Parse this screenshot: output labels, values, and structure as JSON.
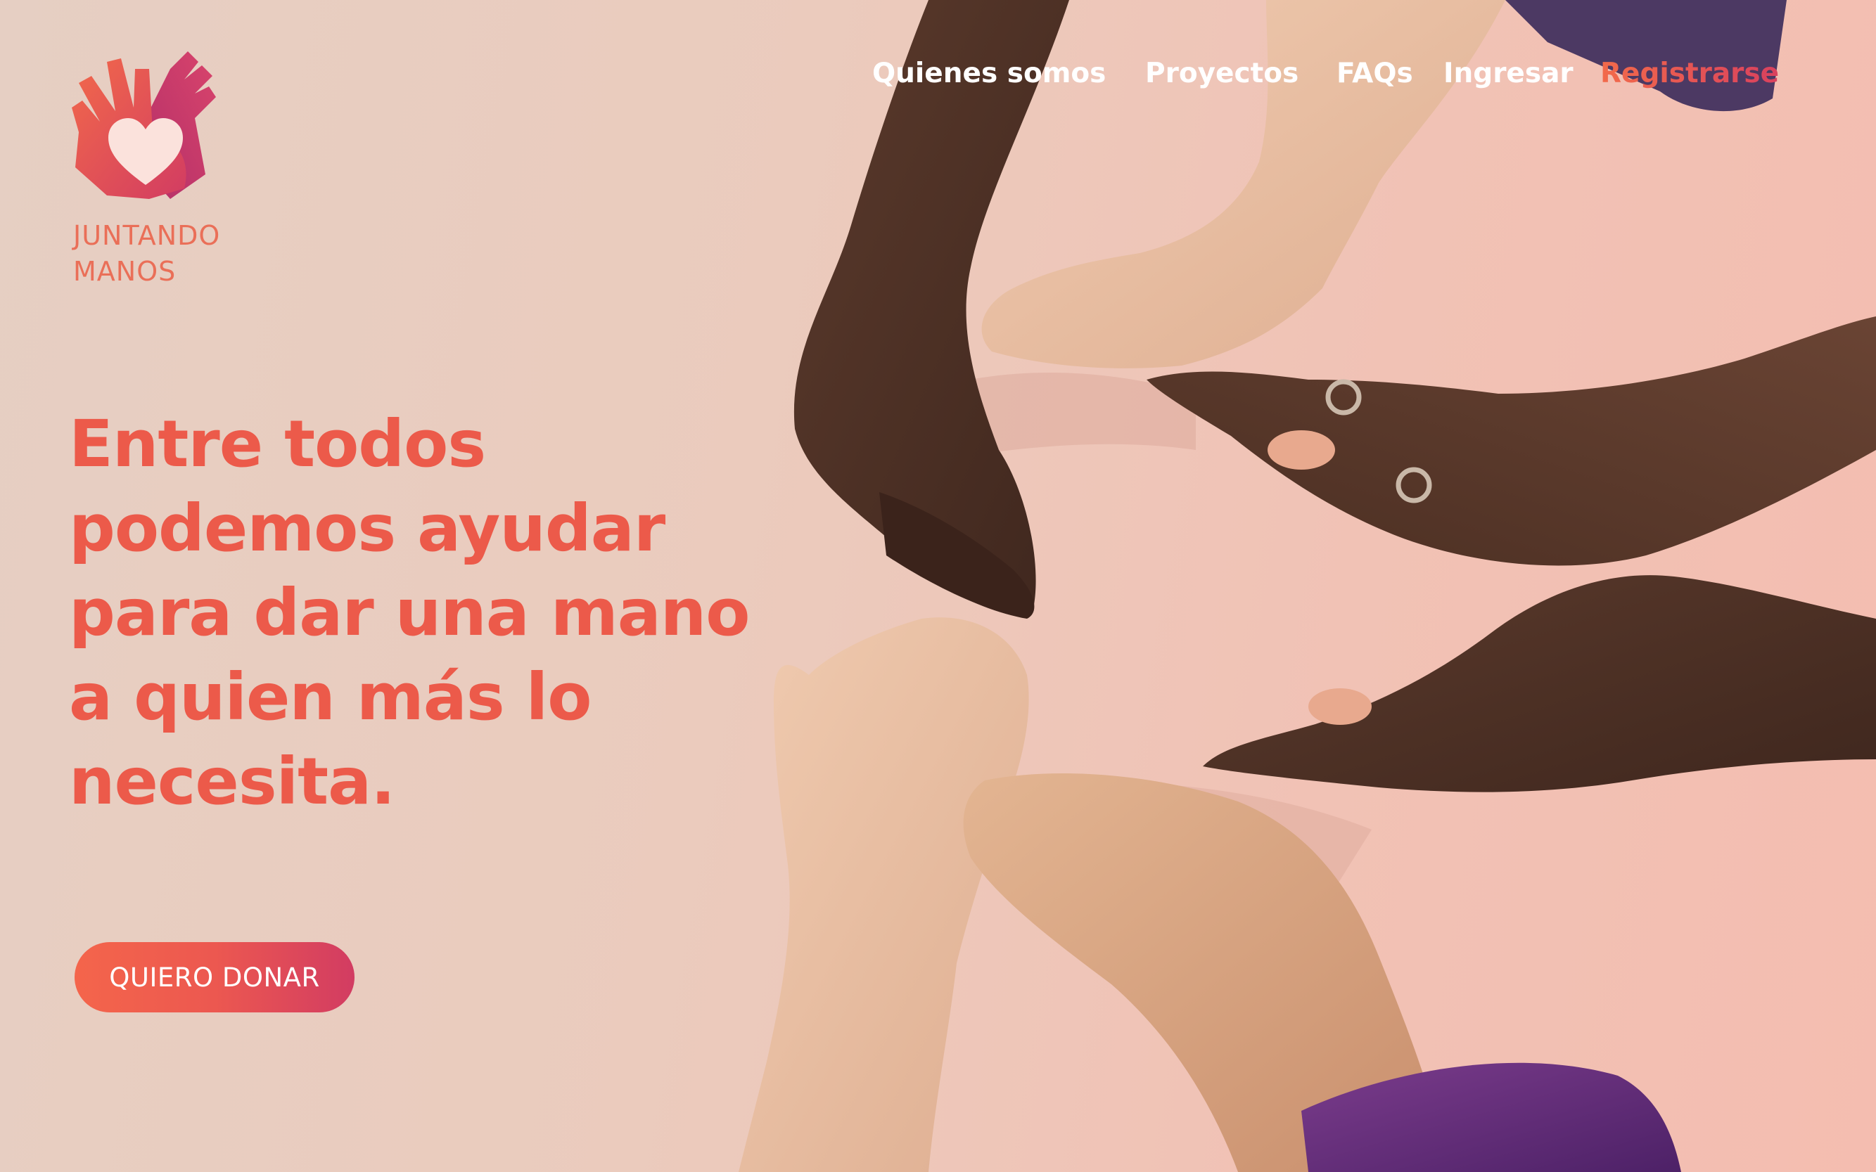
{
  "brand": {
    "name_line1": "JUNTANDO",
    "name_line2": "MANOS",
    "logo_icon": "hands-heart-icon",
    "colors": {
      "primary": "#ec5a4a",
      "gradient_start": "#f4654b",
      "gradient_end": "#d23c62",
      "nav_text": "#ffffff"
    }
  },
  "nav": {
    "items": [
      {
        "label": "Quienes somos"
      },
      {
        "label": "Proyectos"
      },
      {
        "label": "FAQs"
      },
      {
        "label": "Ingresar"
      },
      {
        "label": "Registrarse"
      }
    ]
  },
  "hero": {
    "headline_lines": [
      "Entre todos",
      "podemos ayudar",
      "para dar una mano",
      "a quien más lo",
      "necesita."
    ],
    "cta_label": "QUIERO DONAR"
  }
}
